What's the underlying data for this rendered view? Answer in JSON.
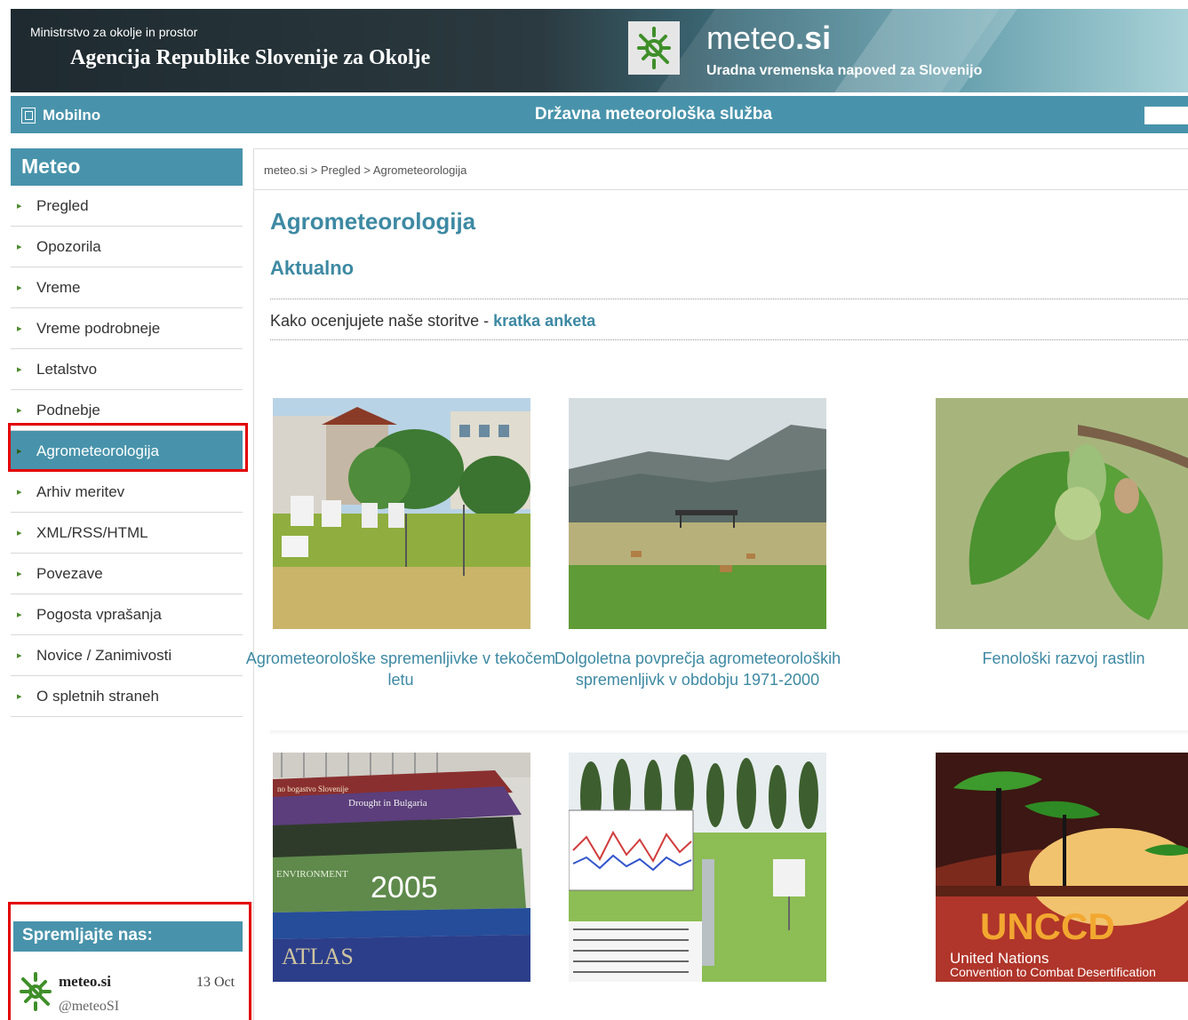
{
  "header": {
    "ministry": "Ministrstvo za okolje in prostor",
    "agency": "Agencija Republike Slovenije za Okolje",
    "site_name_light": "meteo",
    "site_name_bold": ".si",
    "tagline": "Uradna vremenska napoved za Slovenijo"
  },
  "bluebar": {
    "mobile_label": "Mobilno",
    "service_title": "Državna meteorološka služba"
  },
  "sidebar": {
    "title": "Meteo",
    "items": [
      {
        "label": "Pregled"
      },
      {
        "label": "Opozorila"
      },
      {
        "label": "Vreme"
      },
      {
        "label": "Vreme podrobneje"
      },
      {
        "label": "Letalstvo"
      },
      {
        "label": "Podnebje"
      },
      {
        "label": "Agrometeorologija",
        "active": true
      },
      {
        "label": "Arhiv meritev"
      },
      {
        "label": "XML/RSS/HTML"
      },
      {
        "label": "Povezave"
      },
      {
        "label": "Pogosta vprašanja"
      },
      {
        "label": "Novice / Zanimivosti"
      },
      {
        "label": "O spletnih straneh"
      }
    ],
    "follow": {
      "title": "Spremljajte nas:",
      "tweet_name": "meteo.si",
      "tweet_handle": "@meteoSI",
      "tweet_date": "13 Oct"
    }
  },
  "content": {
    "breadcrumb": "meteo.si > Pregled > Agrometeorologija",
    "page_title": "Agrometeorologija",
    "section_title": "Aktualno",
    "survey_text": "Kako ocenjujete naše storitve - ",
    "survey_link": "kratka anketa",
    "tiles": [
      {
        "caption": "Agrometeorološke spremenljivke v tekočem letu",
        "image": "weather-station-photo"
      },
      {
        "caption": "Dolgoletna povprečja agrometeoroloških spremenljivk v obdobju 1971-2000",
        "image": "field-mountains-photo"
      },
      {
        "caption": "Fenološki razvoj rastlin",
        "image": "leaf-bud-photo"
      },
      {
        "caption": "",
        "image": "books-stack-photo",
        "book_texts": [
          "no bogastvo Slovenije",
          "Drought in Bulgaria",
          "ENVIRONMENT",
          "2005",
          "ATLAS"
        ]
      },
      {
        "caption": "",
        "image": "poplar-station-photo"
      },
      {
        "caption": "",
        "image": "unccd-logo",
        "logo_text": "UNCCD",
        "logo_line1": "United Nations",
        "logo_line2": "Convention to Combat Desertification"
      }
    ]
  },
  "colors": {
    "accent": "#4893ab",
    "link": "#3d89a3",
    "highlight_border": "#e20000"
  }
}
